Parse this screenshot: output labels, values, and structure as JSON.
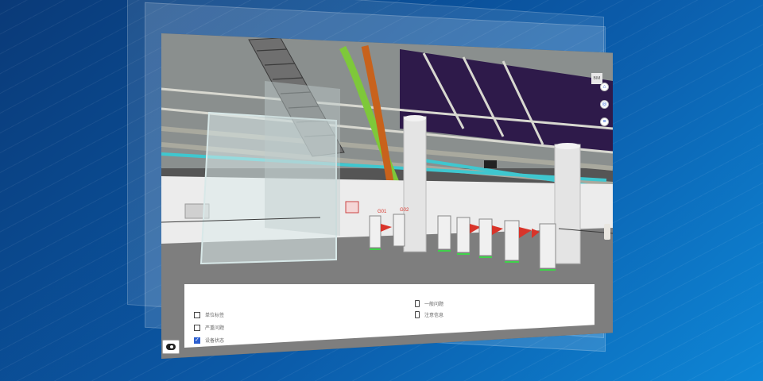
{
  "scene": {
    "gate_tags": [
      "G01",
      "G02"
    ]
  },
  "toolbar": {
    "corner_label": "BIM",
    "buttons": [
      {
        "icon": "home-icon",
        "glyph": "⌂"
      },
      {
        "icon": "locate-icon",
        "glyph": "◎"
      },
      {
        "icon": "layers-icon",
        "glyph": "≡"
      }
    ]
  },
  "panel": {
    "left_options": [
      {
        "label": "单位标签",
        "checked": false
      },
      {
        "label": "严重问题",
        "checked": false
      },
      {
        "label": "设备状态",
        "checked": true
      }
    ],
    "right_options": [
      {
        "label": "一般问题"
      },
      {
        "label": "注意信息"
      }
    ]
  },
  "colors": {
    "accent": "#2c5fd0",
    "pipe_green": "#7ec83a",
    "pipe_orange": "#c8621c",
    "gate_red": "#d8342a",
    "gate_green": "#3fd24a"
  }
}
